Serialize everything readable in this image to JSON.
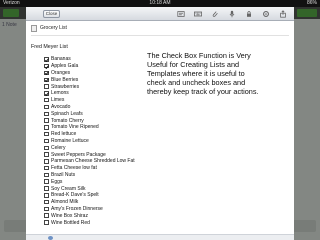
{
  "status_bar": {
    "carrier": "Verizon",
    "time": "10:18 AM",
    "battery": "86%"
  },
  "background_app": {
    "note_text": "1 Note"
  },
  "toolbar": {
    "close_label": "Close",
    "icons": [
      "text-format-icon",
      "keyboard-icon",
      "attachment-icon",
      "microphone-icon",
      "lock-icon",
      "settings-icon",
      "share-icon"
    ]
  },
  "note": {
    "title": "Grocery List",
    "list_heading": "Fred Meyer List",
    "items": [
      {
        "label": "Bananas",
        "checked": true
      },
      {
        "label": "Apples Gala",
        "checked": true
      },
      {
        "label": "Oranges",
        "checked": true
      },
      {
        "label": "Blue Berries",
        "checked": true
      },
      {
        "label": "Strawberries",
        "checked": false
      },
      {
        "label": "Lemons",
        "checked": true
      },
      {
        "label": "Limes",
        "checked": false
      },
      {
        "label": "Avocado",
        "checked": false
      },
      {
        "label": "Spinach Leafs",
        "checked": false
      },
      {
        "label": "Tomato Cherry",
        "checked": false
      },
      {
        "label": "Tomato Vine Ripened",
        "checked": false
      },
      {
        "label": "Red lettuce",
        "checked": false
      },
      {
        "label": "Romaine Lettuce",
        "checked": false
      },
      {
        "label": "Celery",
        "checked": false
      },
      {
        "label": "Sweet Peppers Package",
        "checked": false
      },
      {
        "label": "Parmesan Cheese Shredded Low Fat",
        "checked": false
      },
      {
        "label": "Fetta Cheese low fat",
        "checked": false
      },
      {
        "label": "Brazil Nuts",
        "checked": false
      },
      {
        "label": "Eggs",
        "checked": false
      },
      {
        "label": "Soy Cream Silk",
        "checked": false
      },
      {
        "label": "Bread-K Dave's Spelt",
        "checked": false
      },
      {
        "label": "Almond Milk",
        "checked": false
      },
      {
        "label": "Amy's Frozen Dinnerse",
        "checked": false
      },
      {
        "label": "Wine Box Shiraz",
        "checked": false
      },
      {
        "label": "Wine Bottled Red",
        "checked": false
      }
    ],
    "callout": "The Check Box Function is Very Useful for Creating Lists and Templates where it is useful to check and uncheck boxes and thereby keep track of your actions."
  }
}
